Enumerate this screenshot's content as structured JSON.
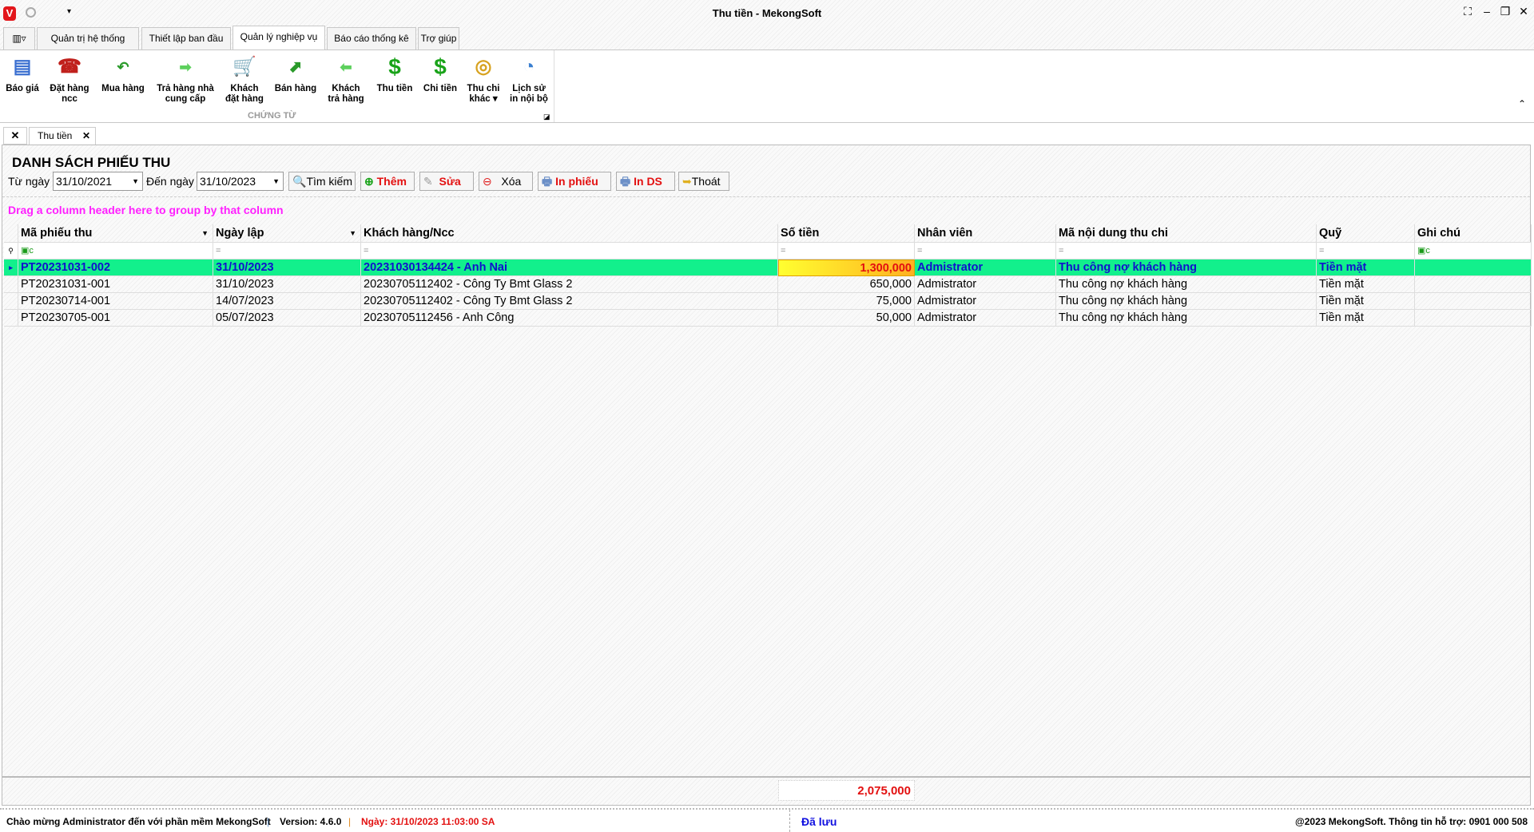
{
  "window": {
    "title": "Thu tiền - MekongSoft"
  },
  "ribbon_tabs": [
    "Quản trị hệ thống",
    "Thiết lập ban đầu",
    "Quản lý nghiệp vụ",
    "Báo cáo thống kê",
    "Trợ giúp"
  ],
  "ribbon_buttons": [
    {
      "l1": "Báo giá",
      "l2": "",
      "icon": "list-icon"
    },
    {
      "l1": "Đặt hàng",
      "l2": "ncc",
      "icon": "phone-icon"
    },
    {
      "l1": "Mua hàng",
      "l2": "",
      "icon": "arrow-back-icon"
    },
    {
      "l1": "Trả hàng nhà",
      "l2": "cung cấp",
      "icon": "arrow-right-icon"
    },
    {
      "l1": "Khách",
      "l2": "đặt hàng",
      "icon": "cart-icon"
    },
    {
      "l1": "Bán hàng",
      "l2": "",
      "icon": "arrow-up-icon"
    },
    {
      "l1": "Khách",
      "l2": "trả hàng",
      "icon": "arrow-left-icon"
    },
    {
      "l1": "Thu tiền",
      "l2": "",
      "icon": "dollar-plus-icon"
    },
    {
      "l1": "Chi tiền",
      "l2": "",
      "icon": "dollar-minus-icon"
    },
    {
      "l1": "Thu chi",
      "l2": "khác ▾",
      "icon": "coins-icon"
    },
    {
      "l1": "Lịch sử",
      "l2": "in nội bộ",
      "icon": "history-icon"
    }
  ],
  "ribbon_group": "CHỨNG TỪ",
  "doc_tab": "Thu tiền",
  "page": {
    "title": "DANH SÁCH PHIẾU THU",
    "from_label": "Từ ngày",
    "from_value": "31/10/2021",
    "to_label": "Đến ngày",
    "to_value": "31/10/2023",
    "search": "Tìm kiếm",
    "add": "Thêm",
    "edit": "Sửa",
    "delete": "Xóa",
    "print": "In phiếu",
    "print_list": "In DS",
    "exit": "Thoát",
    "group_hint": "Drag a column header here to group by that column"
  },
  "columns": [
    "Mã phiếu thu",
    "Ngày lập",
    "Khách hàng/Ncc",
    "Số tiền",
    "Nhân viên",
    "Mã nội dung thu chi",
    "Quỹ",
    "Ghi chú"
  ],
  "rows": [
    [
      "PT20231031-002",
      "31/10/2023",
      "20231030134424 - Anh Nai",
      "1,300,000",
      "Admistrator",
      "Thu công nợ khách hàng",
      "Tiền mặt",
      ""
    ],
    [
      "PT20231031-001",
      "31/10/2023",
      "20230705112402 - Công Ty Bmt Glass 2",
      "650,000",
      "Admistrator",
      "Thu công nợ khách hàng",
      "Tiền mặt",
      ""
    ],
    [
      "PT20230714-001",
      "14/07/2023",
      "20230705112402 - Công Ty Bmt Glass 2",
      "75,000",
      "Admistrator",
      "Thu công nợ khách hàng",
      "Tiền mặt",
      ""
    ],
    [
      "PT20230705-001",
      "05/07/2023",
      "20230705112456 - Anh Công",
      "50,000",
      "Admistrator",
      "Thu công nợ khách hàng",
      "Tiền mặt",
      ""
    ]
  ],
  "total": "2,075,000",
  "status": {
    "welcome": "Chào mừng Administrator đến với phần mềm MekongSoft",
    "version": "Version: 4.6.0",
    "date": "Ngày: 31/10/2023 11:03:00 SA",
    "saved": "Đã lưu",
    "copyright": "@2023 MekongSoft. Thông tin hỗ trợ: 0901 000 508"
  }
}
